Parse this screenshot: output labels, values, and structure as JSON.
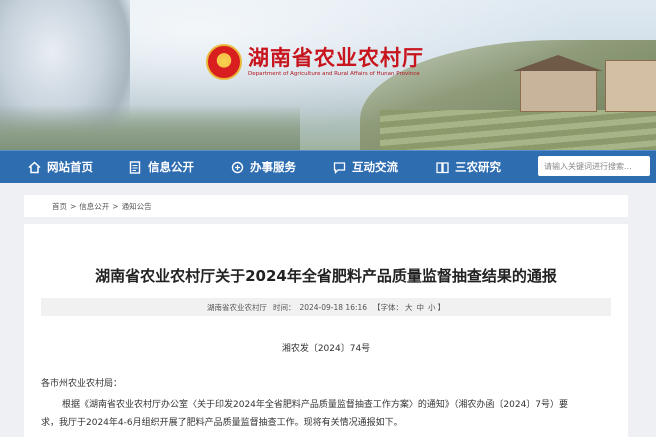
{
  "header": {
    "site_title": "湖南省农业农村厅",
    "site_subtitle": "Department of Agriculture and Rural Affairs of Hunan Province"
  },
  "nav": {
    "items": [
      {
        "label": "网站首页",
        "icon": "home-icon"
      },
      {
        "label": "信息公开",
        "icon": "document-icon"
      },
      {
        "label": "办事服务",
        "icon": "service-icon"
      },
      {
        "label": "互动交流",
        "icon": "chat-icon"
      },
      {
        "label": "三农研究",
        "icon": "book-icon"
      }
    ],
    "search_placeholder": "请输入关键词进行搜索..."
  },
  "breadcrumb": {
    "items": [
      "首页",
      "信息公开",
      "通知公告"
    ],
    "separator": ">"
  },
  "article": {
    "title": "湖南省农业农村厅关于2024年全省肥料产品质量监督抽查结果的通报",
    "source": "湖南省农业农村厅",
    "time_label": "时间：",
    "time": "2024-09-18 16:16",
    "font_label": "【字体：",
    "font_sizes": [
      "大",
      "中",
      "小"
    ],
    "font_close": "】",
    "doc_number": "湘农发〔2024〕74号",
    "salutation": "各市州农业农村局：",
    "para1_line1": "根据《湖南省农业农村厅办公室〈关于印发2024年全省肥料产品质量监督抽查工作方案〉的通知》（湘农办函〔2024〕7号）要",
    "para1_line2": "求，我厅于2024年4-6月组织开展了肥料产品质量监督抽查工作。现将有关情况通报如下。"
  },
  "colors": {
    "nav_bg": "#2f6db1",
    "title_red": "#c8141c",
    "page_bg": "#eef0f3"
  }
}
